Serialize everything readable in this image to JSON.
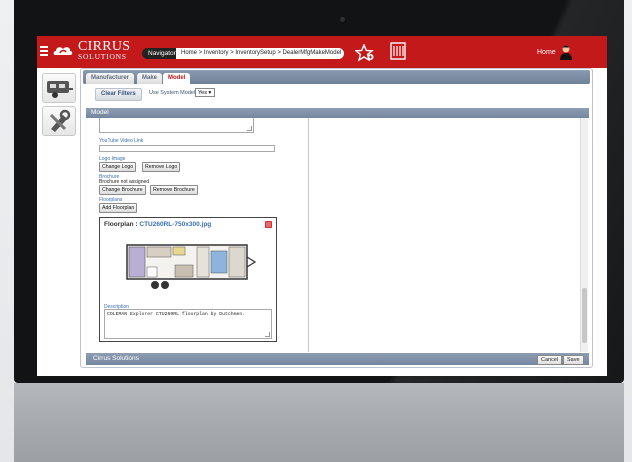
{
  "app": {
    "logo_text": "CIRRUS",
    "logo_sub": "SOLUTIONS",
    "navigator_label": "Navigator",
    "breadcrumb": "Home > Inventory > InventorySetup > DealerMfgMakeModel",
    "home_label": "Home"
  },
  "tabs": [
    {
      "label": "Manufacturer",
      "active": false
    },
    {
      "label": "Make",
      "active": false
    },
    {
      "label": "Model",
      "active": true
    }
  ],
  "filters": {
    "clear_label": "Clear Filters",
    "use_system_models_label": "Use System Models",
    "use_system_models_value": "Yes"
  },
  "section_title": "Model",
  "form": {
    "youtube_label": "YouTube Video Link",
    "youtube_value": "",
    "logo_label": "Logo Image",
    "change_logo": "Change Logo",
    "remove_logo": "Remove Logo",
    "brochure_label": "Brochure",
    "brochure_status": "Brochure not assigned",
    "change_brochure": "Change Brochure",
    "remove_brochure": "Remove Brochure",
    "floorplans_label": "Floorplans",
    "add_floorplan": "Add Floorplan"
  },
  "floorplan": {
    "title_prefix": "Floorplan : ",
    "file_name": "CTU260RL-750x300.jpg",
    "description_label": "Description",
    "description_value": "COLEMAN Explorer CTU260RL floorplan by Dutchmen."
  },
  "footer": {
    "label": "Cirrus Solutions",
    "cancel": "Cancel",
    "save": "Save"
  },
  "colors": {
    "brand_red": "#c4191b",
    "header_blue": "#7486a0",
    "link_blue": "#3b6fb5"
  },
  "icons": [
    "menu-icon",
    "cirrus-logo-icon",
    "favorite-star-icon",
    "list-icon",
    "user-icon",
    "rv-trailer-icon",
    "tools-icon",
    "close-icon"
  ]
}
